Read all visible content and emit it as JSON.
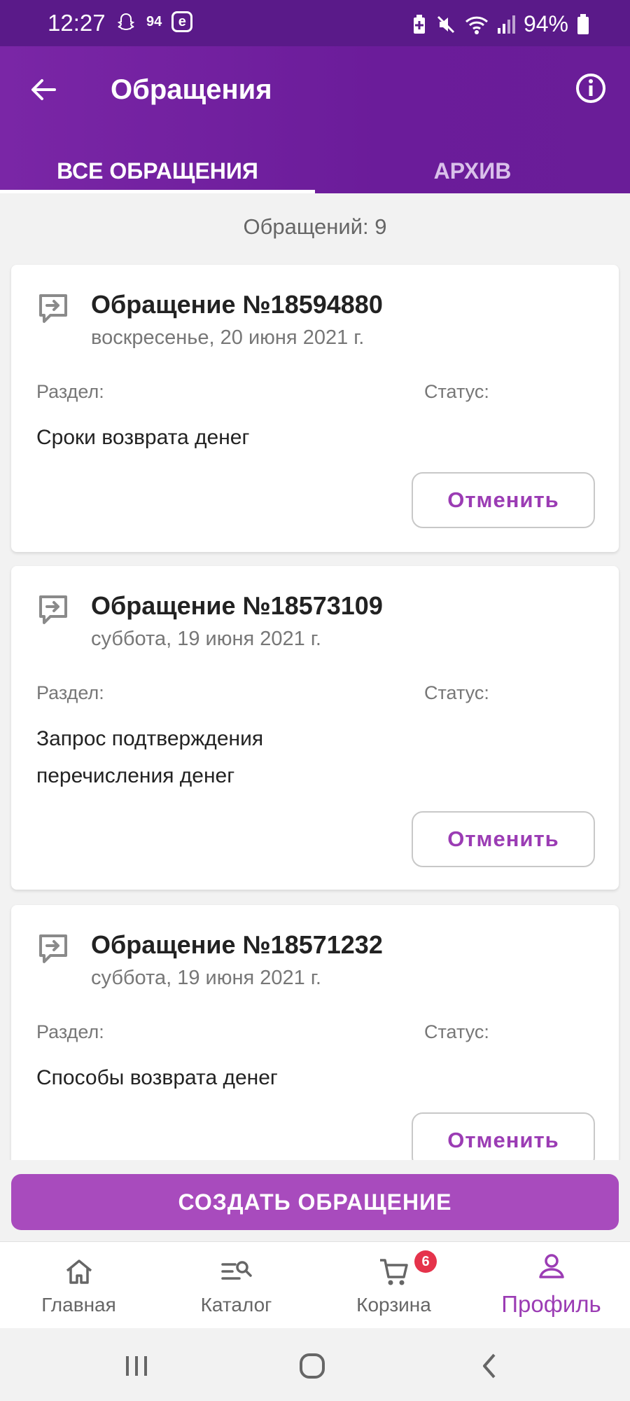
{
  "status_bar": {
    "time": "12:27",
    "notif_temp": "94",
    "notif_e": "e",
    "battery": "94%"
  },
  "header": {
    "title": "Обращения",
    "tabs": [
      {
        "label": "ВСЕ ОБРАЩЕНИЯ",
        "active": true
      },
      {
        "label": "АРХИВ",
        "active": false
      }
    ]
  },
  "summary": {
    "count_text": "Обращений: 9"
  },
  "tickets": [
    {
      "title": "Обращение №18594880",
      "date": "воскресенье, 20 июня 2021 г.",
      "section_label": "Раздел:",
      "status_label": "Статус:",
      "section_value": "Сроки возврата денег",
      "cancel_label": "Отменить"
    },
    {
      "title": "Обращение №18573109",
      "date": "суббота, 19 июня 2021 г.",
      "section_label": "Раздел:",
      "status_label": "Статус:",
      "section_value": "Запрос подтверждения перечисления денег",
      "cancel_label": "Отменить"
    },
    {
      "title": "Обращение №18571232",
      "date": "суббота, 19 июня 2021 г.",
      "section_label": "Раздел:",
      "status_label": "Статус:",
      "section_value": "Способы возврата денег",
      "cancel_label": "Отменить"
    }
  ],
  "create_button": {
    "label": "СОЗДАТЬ ОБРАЩЕНИЕ"
  },
  "bottom_nav": {
    "items": [
      {
        "label": "Главная",
        "icon": "home-icon"
      },
      {
        "label": "Каталог",
        "icon": "catalog-search-icon"
      },
      {
        "label": "Корзина",
        "icon": "cart-icon",
        "badge": "6"
      },
      {
        "label": "Профиль",
        "icon": "profile-icon",
        "active": true
      }
    ]
  },
  "colors": {
    "header": "#6b1c9a",
    "accent": "#a84bbd",
    "badge": "#e5334b"
  }
}
